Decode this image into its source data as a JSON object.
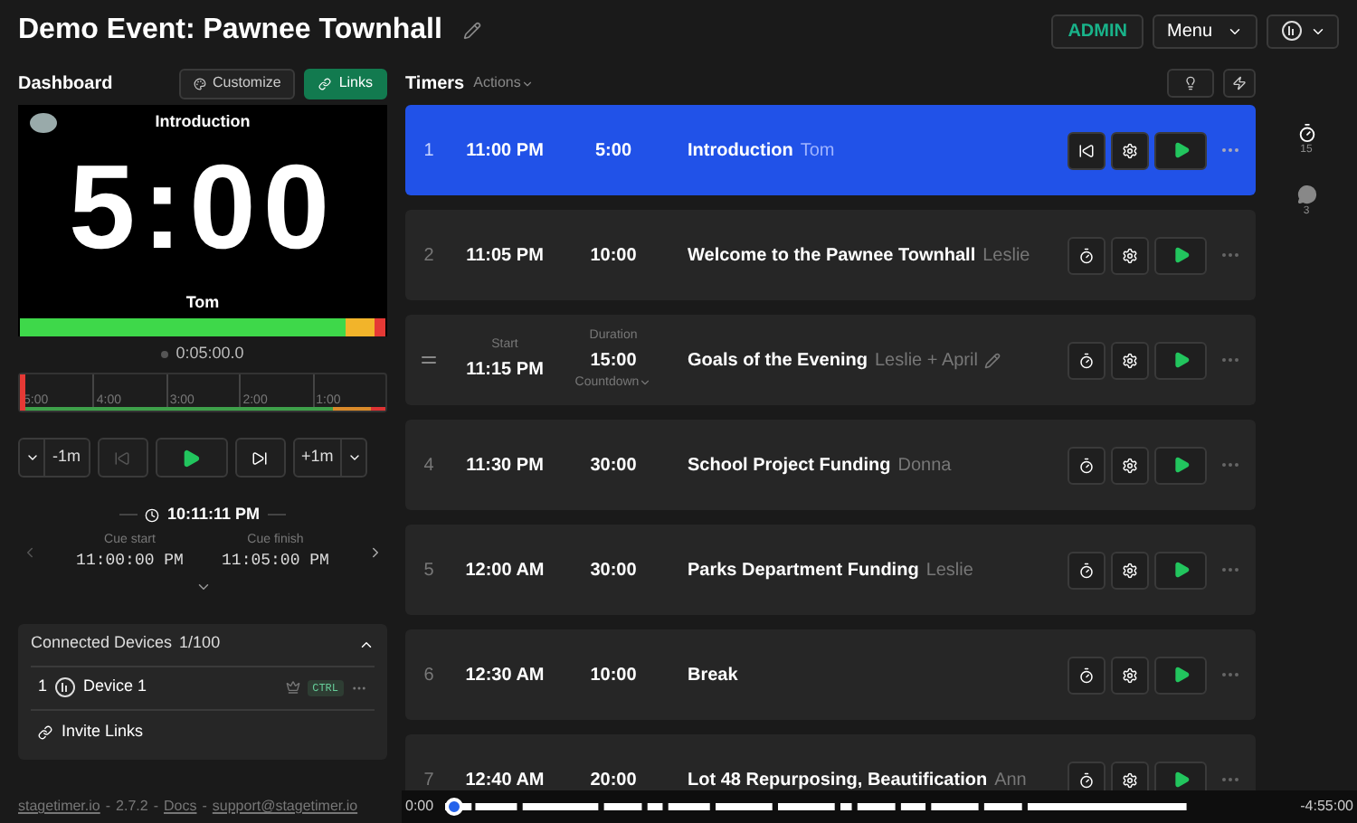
{
  "header": {
    "title": "Demo Event: Pawnee Townhall",
    "role": "ADMIN",
    "menu": "Menu"
  },
  "dashboard": {
    "label": "Dashboard",
    "buttons": [
      {
        "label": "Customize",
        "kind": "customize"
      },
      {
        "label": "Links",
        "kind": "links"
      }
    ]
  },
  "preview": {
    "title": "Introduction",
    "time": "5:00",
    "speaker": "Tom",
    "level": 1
  },
  "elapsed": "0:05:00.0",
  "timeline_ticks": [
    "5:00",
    "4:00",
    "3:00",
    "2:00",
    "1:00"
  ],
  "controls": {
    "minus": "-1m",
    "plus": "+1m"
  },
  "clock": "10:11:11 PM",
  "cues": [
    {
      "label": "Cue start",
      "value": "11:00:00 PM"
    },
    {
      "label": "Cue finish",
      "value": "11:05:00 PM"
    }
  ],
  "devices": {
    "title": "Connected Devices",
    "count": "1/100",
    "expanded": true,
    "items": [
      {
        "index": "1",
        "name": "Device 1",
        "badge": "CTRL"
      }
    ],
    "invite": "Invite Links"
  },
  "footer": [
    {
      "text": "stagetimer.io",
      "kind": "link"
    },
    {
      "text": "-",
      "kind": "text"
    },
    {
      "text": "2.7.2",
      "kind": "text"
    },
    {
      "text": "-",
      "kind": "text"
    },
    {
      "text": "Docs",
      "kind": "link"
    },
    {
      "text": "-",
      "kind": "text"
    },
    {
      "text": "support@stagetimer.io",
      "kind": "link"
    }
  ],
  "timers": {
    "title": "Timers",
    "actions": "Actions",
    "items": [
      {
        "index": "1",
        "start": "11:00 PM",
        "duration": "5:00",
        "title": "Introduction",
        "speaker": "Tom",
        "selected": true,
        "kind": "normal"
      },
      {
        "index": "2",
        "start": "11:05 PM",
        "duration": "10:00",
        "title": "Welcome to the Pawnee Townhall",
        "speaker": "Leslie",
        "selected": false,
        "kind": "normal"
      },
      {
        "start_label": "Start",
        "start": "11:15 PM",
        "duration_label": "Duration",
        "duration": "15:00",
        "type": "Countdown",
        "title": "Goals of the Evening",
        "speaker": "Leslie + April",
        "selected": false,
        "kind": "hovered"
      },
      {
        "index": "4",
        "start": "11:30 PM",
        "duration": "30:00",
        "title": "School Project Funding",
        "speaker": "Donna",
        "selected": false,
        "kind": "normal"
      },
      {
        "index": "5",
        "start": "12:00 AM",
        "duration": "30:00",
        "title": "Parks Department Funding",
        "speaker": "Leslie",
        "selected": false,
        "kind": "normal"
      },
      {
        "index": "6",
        "start": "12:30 AM",
        "duration": "10:00",
        "title": "Break",
        "selected": false,
        "kind": "normal"
      },
      {
        "index": "7",
        "start": "12:40 AM",
        "duration": "20:00",
        "title": "Lot 48 Repurposing, Beautification",
        "speaker": "Ann",
        "selected": false,
        "kind": "normal"
      }
    ]
  },
  "sidebar": [
    {
      "count": "15",
      "kind": "timers"
    },
    {
      "count": "3",
      "kind": "messages"
    }
  ],
  "playback": {
    "start": "0:00",
    "remaining": "-4:55:00",
    "level": 0
  }
}
